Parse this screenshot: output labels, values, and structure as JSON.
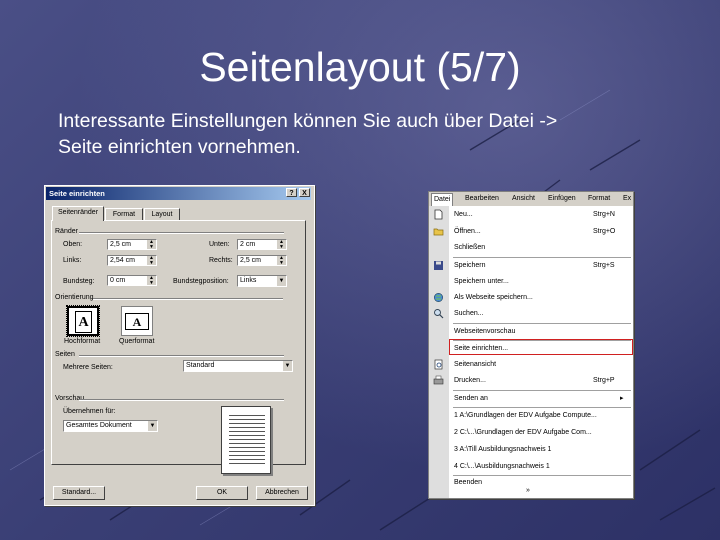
{
  "slide": {
    "title": "Seitenlayout (5/7)",
    "text_line1": "Interessante Einstellungen können Sie auch über Datei ->",
    "text_line2": "Seite einrichten vornehmen."
  },
  "dialog": {
    "title": "Seite einrichten",
    "title_buttons": [
      "?",
      "X"
    ],
    "tabs": [
      "Seitenränder",
      "Format",
      "Layout"
    ],
    "margins_label": "Ränder",
    "top_label": "Oben:",
    "top_value": "2,5 cm",
    "bottom_label": "Unten:",
    "bottom_value": "2 cm",
    "left_label": "Links:",
    "left_value": "2,54 cm",
    "right_label": "Rechts:",
    "right_value": "2,5 cm",
    "gutter_label": "Bundsteg:",
    "gutter_value": "0 cm",
    "gutter_pos_label": "Bundstegposition:",
    "gutter_pos_value": "Links",
    "orientation_label": "Orientierung",
    "portrait_label": "Hochformat",
    "landscape_label": "Querformat",
    "orient_glyph": "A",
    "pages_label": "Seiten",
    "multiple_pages_label": "Mehrere Seiten:",
    "multiple_pages_value": "Standard",
    "preview_label": "Vorschau",
    "apply_to_label": "Übernehmen für:",
    "apply_to_value": "Gesamtes Dokument",
    "default_button": "Standard...",
    "ok_button": "OK",
    "cancel_button": "Abbrechen"
  },
  "menu": {
    "menubar": [
      "Datei",
      "Bearbeiten",
      "Ansicht",
      "Einfügen",
      "Format",
      "Ex"
    ],
    "items": [
      {
        "label": "Neu...",
        "shortcut": "Strg+N",
        "icon": "new-document"
      },
      {
        "label": "Öffnen...",
        "shortcut": "Strg+O",
        "icon": "open-folder"
      },
      {
        "label": "Schließen",
        "shortcut": "",
        "icon": ""
      },
      {
        "label": "Speichern",
        "shortcut": "Strg+S",
        "icon": "save-disk"
      },
      {
        "label": "Speichern unter...",
        "shortcut": "",
        "icon": ""
      },
      {
        "label": "Als Webseite speichern...",
        "shortcut": "",
        "icon": "web-save"
      },
      {
        "label": "Suchen...",
        "shortcut": "",
        "icon": "search"
      },
      {
        "label": "Webseitenvorschau",
        "shortcut": "",
        "icon": ""
      },
      {
        "label": "Seite einrichten...",
        "shortcut": "",
        "icon": ""
      },
      {
        "label": "Seitenansicht",
        "shortcut": "",
        "icon": "print-preview"
      },
      {
        "label": "Drucken...",
        "shortcut": "Strg+P",
        "icon": "printer"
      },
      {
        "label": "Senden an",
        "shortcut": "▸",
        "icon": ""
      },
      {
        "label": "1 A:\\Grundlagen der EDV Aufgabe Compute...",
        "shortcut": "",
        "icon": ""
      },
      {
        "label": "2 C:\\...\\Grundlagen der EDV Aufgabe Com...",
        "shortcut": "",
        "icon": ""
      },
      {
        "label": "3 A:\\Till Ausbildungsnachweis 1",
        "shortcut": "",
        "icon": ""
      },
      {
        "label": "4 C:\\...\\Ausbildungsnachweis 1",
        "shortcut": "",
        "icon": ""
      },
      {
        "label": "Beenden",
        "shortcut": "",
        "icon": ""
      }
    ],
    "expand_glyph": "»"
  },
  "colors": {
    "background": "#3d4279",
    "titlebar": "#0a246a",
    "highlight": "#d02020"
  }
}
